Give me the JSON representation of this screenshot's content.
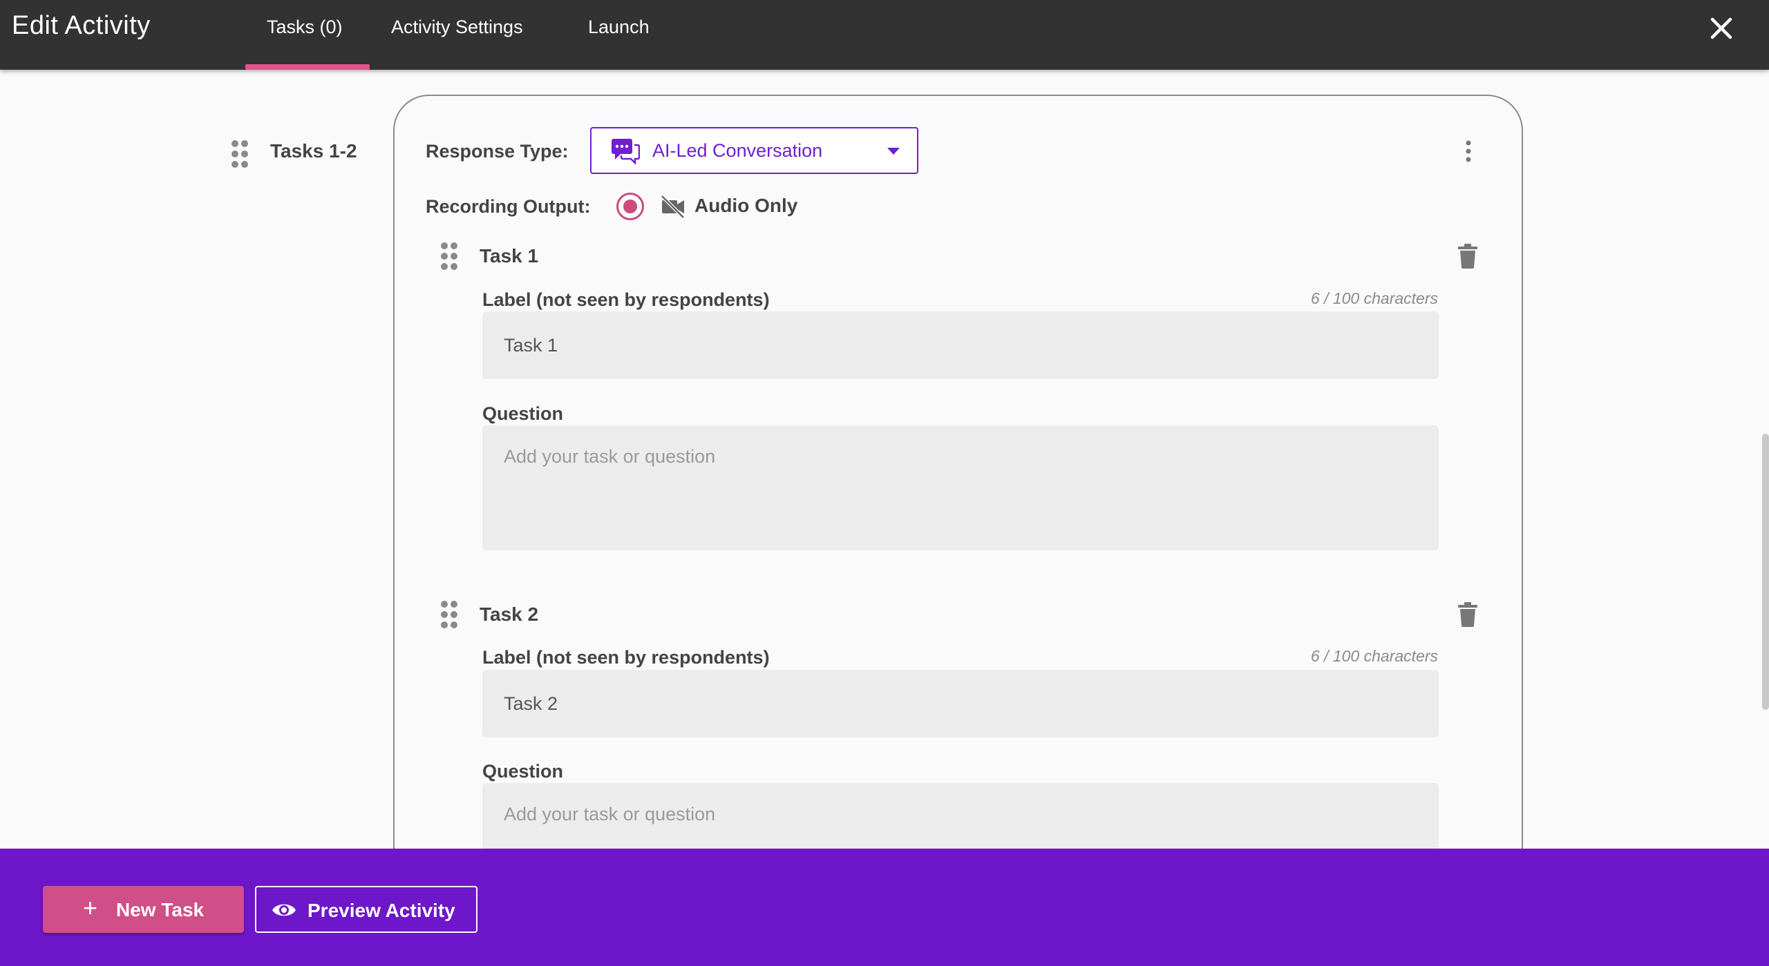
{
  "header": {
    "title": "Edit Activity",
    "tabs": [
      {
        "label": "Tasks (0)",
        "active": true
      },
      {
        "label": "Activity Settings",
        "active": false
      },
      {
        "label": "Launch",
        "active": false
      }
    ],
    "close_icon": "close-icon"
  },
  "sidebar": {
    "group_label": "Tasks 1-2"
  },
  "card": {
    "response_type_label": "Response Type:",
    "response_type_value": "AI-Led Conversation",
    "recording_output_label": "Recording Output:",
    "recording_output_value": "Audio Only",
    "tasks": [
      {
        "title": "Task 1",
        "label_caption": "Label (not seen by respondents)",
        "char_count": "6 / 100 characters",
        "label_value": "Task 1",
        "question_caption": "Question",
        "question_placeholder": "Add your task or question"
      },
      {
        "title": "Task 2",
        "label_caption": "Label (not seen by respondents)",
        "char_count": "6 / 100 characters",
        "label_value": "Task 2",
        "question_caption": "Question",
        "question_placeholder": "Add your task or question"
      }
    ]
  },
  "footer": {
    "new_task_label": "New Task",
    "preview_label": "Preview Activity"
  },
  "colors": {
    "topbar": "#323232",
    "accent_pink": "#d04f88",
    "accent_purple": "#6e16c9"
  }
}
